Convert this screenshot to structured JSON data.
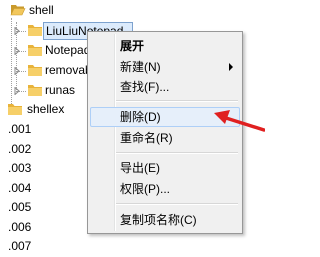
{
  "tree": {
    "nodes": [
      {
        "id": "shell",
        "label": "shell"
      },
      {
        "id": "liuliu",
        "label": "LiuLiuNotepad"
      },
      {
        "id": "notepad",
        "label": "Notepad"
      },
      {
        "id": "removable",
        "label": "removable"
      },
      {
        "id": "runas",
        "label": "runas"
      },
      {
        "id": "shellex",
        "label": "shellex"
      },
      {
        "id": "k001",
        "label": ".001"
      },
      {
        "id": "k002",
        "label": ".002"
      },
      {
        "id": "k003",
        "label": ".003"
      },
      {
        "id": "k004",
        "label": ".004"
      },
      {
        "id": "k005",
        "label": ".005"
      },
      {
        "id": "k006",
        "label": ".006"
      },
      {
        "id": "k007",
        "label": ".007"
      }
    ]
  },
  "context_menu": {
    "items": [
      {
        "label": "展开"
      },
      {
        "label": "新建(N)"
      },
      {
        "label": "查找(F)..."
      },
      {
        "label": "删除(D)"
      },
      {
        "label": "重命名(R)"
      },
      {
        "label": "导出(E)"
      },
      {
        "label": "权限(P)..."
      },
      {
        "label": "复制项名称(C)"
      }
    ]
  },
  "colors": {
    "folder": "#e8b33a",
    "selection": "#dcebfc",
    "menu_highlight": "#e6effa",
    "annotation_arrow": "#e02020"
  }
}
